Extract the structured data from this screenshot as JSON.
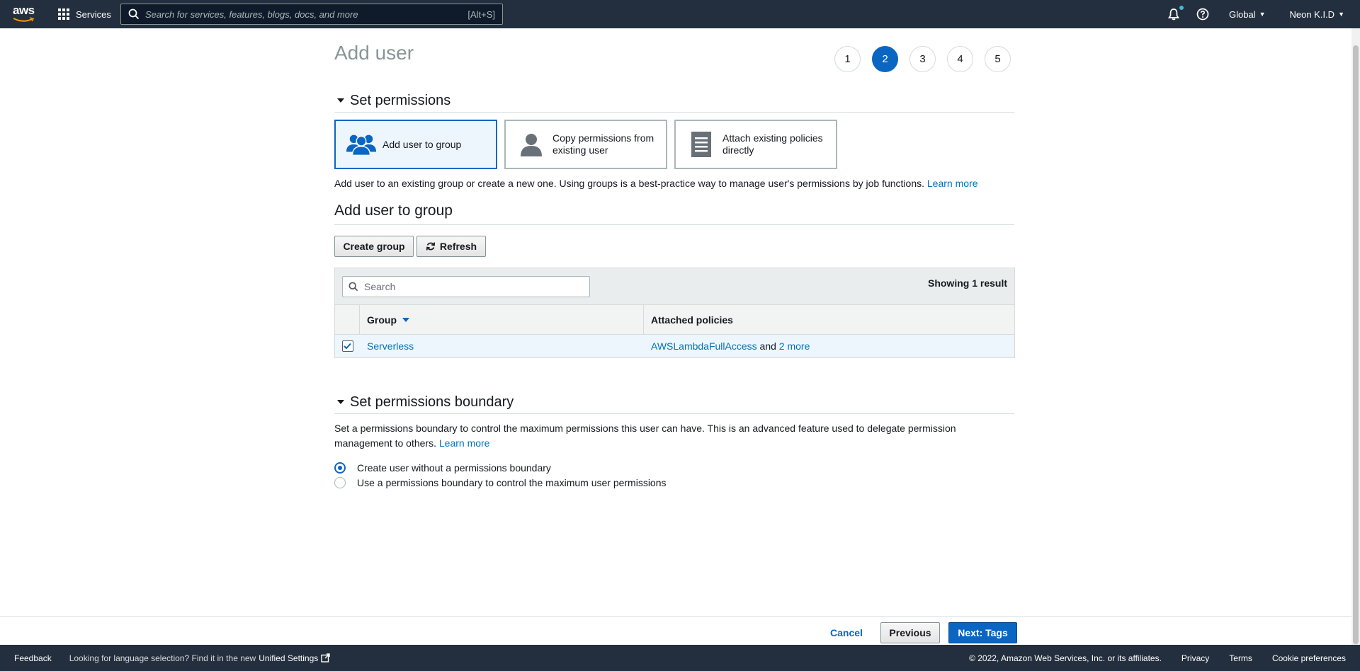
{
  "topnav": {
    "logo_text": "aws",
    "services_label": "Services",
    "search_placeholder": "Search for services, features, blogs, docs, and more",
    "search_shortcut": "[Alt+S]",
    "region": "Global",
    "account": "Neon K.I.D"
  },
  "page": {
    "title": "Add user",
    "steps": [
      "1",
      "2",
      "3",
      "4",
      "5"
    ],
    "active_step": "2"
  },
  "set_permissions": {
    "heading": "Set permissions",
    "options": [
      {
        "label": "Add user to group",
        "icon": "users-group-icon",
        "selected": true
      },
      {
        "label": "Copy permissions from existing user",
        "icon": "user-icon",
        "selected": false
      },
      {
        "label": "Attach existing policies directly",
        "icon": "document-icon",
        "selected": false
      }
    ],
    "description": "Add user to an existing group or create a new one. Using groups is a best-practice way to manage user's permissions by job functions.",
    "learn_more": "Learn more"
  },
  "add_user_to_group": {
    "heading": "Add user to group",
    "create_group_label": "Create group",
    "refresh_label": "Refresh",
    "search_placeholder": "Search",
    "showing": "Showing 1 result",
    "columns": [
      "Group",
      "Attached policies"
    ],
    "rows": [
      {
        "checked": true,
        "group": "Serverless",
        "policy": "AWSLambdaFullAccess",
        "and_text": "and",
        "more": "2 more"
      }
    ]
  },
  "permissions_boundary": {
    "heading": "Set permissions boundary",
    "description": "Set a permissions boundary to control the maximum permissions this user can have. This is an advanced feature used to delegate permission management to others.",
    "learn_more": "Learn more",
    "options": [
      {
        "label": "Create user without a permissions boundary",
        "selected": true
      },
      {
        "label": "Use a permissions boundary to control the maximum user permissions",
        "selected": false
      }
    ]
  },
  "actions": {
    "cancel": "Cancel",
    "previous": "Previous",
    "next": "Next: Tags"
  },
  "footer": {
    "feedback": "Feedback",
    "language_note": "Looking for language selection? Find it in the new",
    "unified_settings": "Unified Settings",
    "copyright": "© 2022, Amazon Web Services, Inc. or its affiliates.",
    "privacy": "Privacy",
    "terms": "Terms",
    "cookie_preferences": "Cookie preferences"
  },
  "colors": {
    "nav_bg": "#232f3e",
    "accent": "#0a66c2",
    "selected_bg": "#eef6fd"
  }
}
